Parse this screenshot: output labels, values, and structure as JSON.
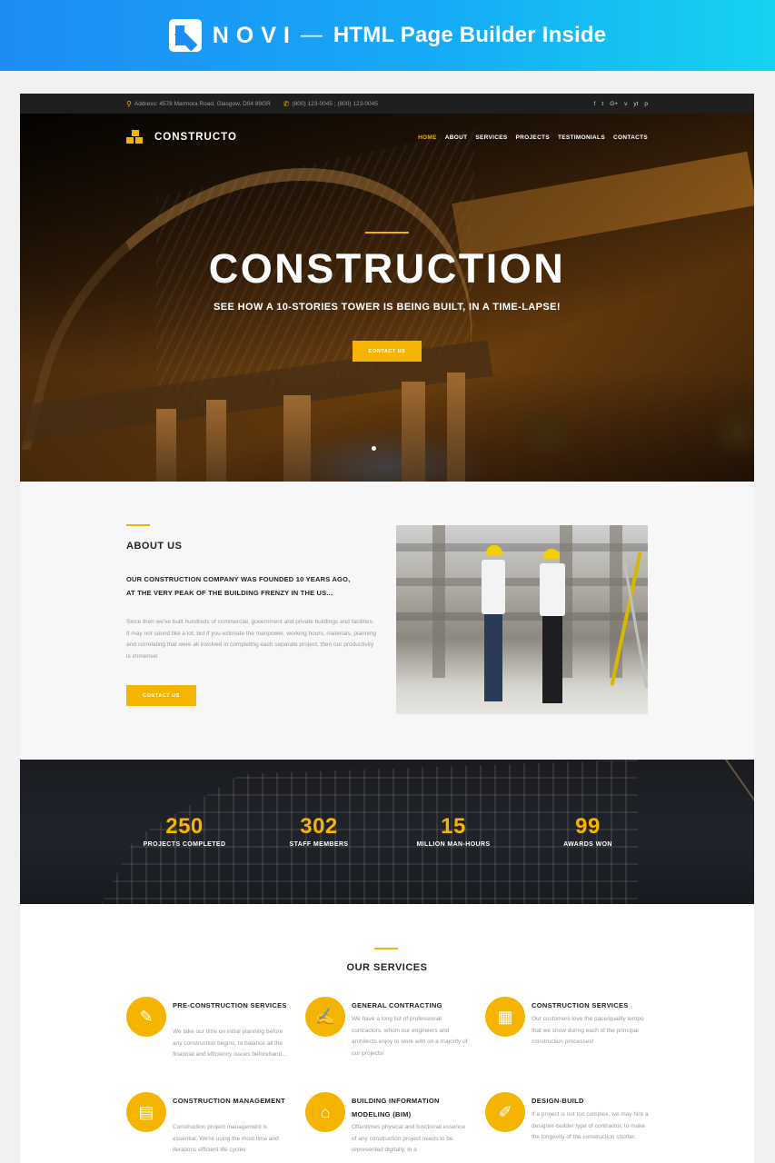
{
  "banner": {
    "brand": "NOVI",
    "dash": "—",
    "tagline": "HTML Page Builder Inside"
  },
  "topbar": {
    "address": "Address: 4578 Marmora Road, Glasgow, D04 89GR",
    "phones": "(800) 123-0045 ; (800) 123-0045",
    "social": [
      "f",
      "t",
      "G+",
      "v",
      "yt",
      "p"
    ]
  },
  "nav": {
    "brand": "CONSTRUCTO",
    "links": [
      "HOME",
      "ABOUT",
      "SERVICES",
      "PROJECTS",
      "TESTIMONIALS",
      "CONTACTS"
    ],
    "active_index": 0
  },
  "hero": {
    "title": "CONSTRUCTION",
    "subtitle": "SEE HOW A 10-STORIES TOWER IS BEING BUILT, IN A TIME-LAPSE!",
    "button": "CONTACT US"
  },
  "about": {
    "heading": "ABOUT US",
    "lead": "OUR CONSTRUCTION COMPANY WAS FOUNDED 10 YEARS AGO, AT THE VERY PEAK OF THE BUILDING FRENZY IN THE US...",
    "body": "Since then we've built hundreds of commercial, government and private buildings and facilities. It may not sound like a lot, but if you estimate the manpower, working hours, materials, planning and correlating that were all involved in completing each separate project, then our productivity is immense!",
    "button": "CONTACT US"
  },
  "stats": [
    {
      "num": "250",
      "label": "PROJECTS COMPLETED"
    },
    {
      "num": "302",
      "label": "STAFF MEMBERS"
    },
    {
      "num": "15",
      "label": "MILLION MAN-HOURS"
    },
    {
      "num": "99",
      "label": "AWARDS WON"
    }
  ],
  "services": {
    "heading": "OUR SERVICES",
    "items": [
      {
        "title": "PRE-CONSTRUCTION SERVICES",
        "desc": "We take our time on initial planning before any construction begins, to balance all the financial and efficiency issues beforehand...",
        "icon": "✎"
      },
      {
        "title": "GENERAL CONTRACTING",
        "desc": "We have a long list of professional contractors, whom our engineers and architects enjoy to work with on a majority of our projects!",
        "icon": "✍"
      },
      {
        "title": "CONSTRUCTION SERVICES",
        "desc": "Our customers love the pace/quality tempo that we show during each of the principal construction processes!",
        "icon": "▦"
      },
      {
        "title": "CONSTRUCTION MANAGEMENT",
        "desc": "Construction project management is essential. We're using the most time and iterations efficient life cycles",
        "icon": "▤"
      },
      {
        "title": "BUILDING INFORMATION MODELING (BIM)",
        "desc": "Oftentimes physical and functional essence of any construction project needs to be represented digitally, in a",
        "icon": "⌂"
      },
      {
        "title": "DESIGN-BUILD",
        "desc": "If a project is not too complex, we may hire a designer-builder type of contractor, to make the longevity of the construction shorter.",
        "icon": "✐"
      }
    ]
  },
  "colors": {
    "accent": "#f5b400",
    "banner_start": "#1d8cf5",
    "banner_end": "#15d3ef",
    "dark": "#1f1f1f"
  }
}
